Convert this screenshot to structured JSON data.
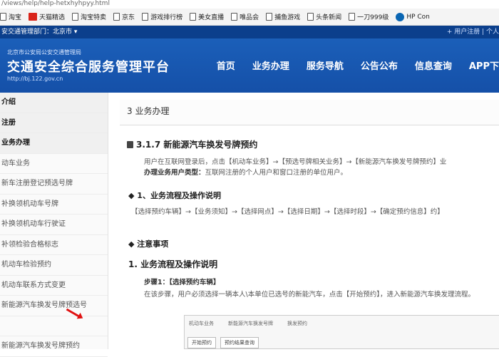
{
  "browser": {
    "url": "/views/help/help-hetxhyhpyy.html",
    "bookmarks": [
      {
        "label": "淘宝",
        "icon": "page-icon"
      },
      {
        "label": "天猫精选",
        "icon": "tmall-icon"
      },
      {
        "label": "淘宝特卖",
        "icon": "page-icon"
      },
      {
        "label": "京东",
        "icon": "page-icon"
      },
      {
        "label": "游戏排行榜",
        "icon": "page-icon"
      },
      {
        "label": "美女直播",
        "icon": "page-icon"
      },
      {
        "label": "唯品会",
        "icon": "page-icon"
      },
      {
        "label": "捕鱼游戏",
        "icon": "page-icon"
      },
      {
        "label": "头条新闻",
        "icon": "page-icon"
      },
      {
        "label": "一刀999级",
        "icon": "page-icon"
      },
      {
        "label": "HP Con",
        "icon": "hp-icon"
      }
    ]
  },
  "site": {
    "top_left": "安交通管理部门：北京市 ▾",
    "top_right": "+ 用户注册  | 个人",
    "org_small": "北京市公安局公安交通管理局",
    "title": "交通安全综合服务管理平台",
    "url": "http://bj.122.gov.cn",
    "nav": [
      "首页",
      "业务办理",
      "服务导航",
      "公告公布",
      "信息查询",
      "APP下"
    ]
  },
  "sidebar": {
    "items": [
      {
        "label": "介绍",
        "kind": "top"
      },
      {
        "label": "注册",
        "kind": "top"
      },
      {
        "label": "业务办理",
        "kind": "top"
      },
      {
        "label": "动车业务",
        "kind": "sub"
      },
      {
        "label": "新车注册登记预选号牌",
        "kind": "sub"
      },
      {
        "label": "补换领机动车号牌",
        "kind": "sub"
      },
      {
        "label": "补换领机动车行驶证",
        "kind": "sub"
      },
      {
        "label": "补领检验合格标志",
        "kind": "sub"
      },
      {
        "label": "机动车检验预约",
        "kind": "sub"
      },
      {
        "label": "机动车联系方式变更",
        "kind": "sub"
      },
      {
        "label": "新能源汽车换发号牌预选号",
        "kind": "sub"
      },
      {
        "label": "",
        "kind": "sub"
      },
      {
        "label": "新能源汽车换发号牌预约",
        "kind": "sub"
      }
    ]
  },
  "content": {
    "breadcrumb": "3 业务办理",
    "section_title": "3.1.7 新能源汽车换发号牌预约",
    "intro_line1": "用户在互联网登录后，点击【机动车业务】→【预选号牌相关业务】→【新能源汽车换发号牌预约】业",
    "intro_bold": "办理业务用户类型：",
    "intro_line2": "互联网注册的个人用户和窗口注册的单位用户。",
    "h_flow": "◆ 1、业务流程及操作说明",
    "flow_text": "【选择预约车辆】→【业务须知】→【选择网点】→【选择日期】→【选择时段】→【确定预约信息】约】",
    "h_notes": "◆ 注意事项",
    "h2": "1. 业务流程及操作说明",
    "step_label": "步骤1：【选择预约车辆】",
    "step_desc": "在该步骤，用户必须选择一辆本人\\本单位已选号的新能汽车，点击【开始预约】，进入新能源汽车换发理流程。",
    "shot_tabs": [
      "机动车业务",
      "新能源汽车换发号牌",
      "换发预约"
    ],
    "shot_buttons": [
      "开始预约",
      "预约结果查询"
    ]
  }
}
